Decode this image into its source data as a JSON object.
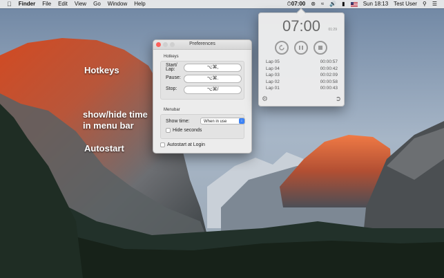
{
  "menubar": {
    "apple": "",
    "app_name": "Finder",
    "menus": [
      "File",
      "Edit",
      "View",
      "Go",
      "Window",
      "Help"
    ],
    "tray_timer": "07:00",
    "clock": "Sun 18:13",
    "user": "Test User"
  },
  "annotations": {
    "hotkeys": "Hotkeys",
    "showhide_line1": "show/hide time",
    "showhide_line2": "in menu bar",
    "autostart": "Autostart"
  },
  "preferences": {
    "title": "Preferences",
    "hotkeys_group": "Hotkeys",
    "hotkeys": [
      {
        "label": "Start/\nLap:",
        "value": "⌥⌘,"
      },
      {
        "label": "Pause:",
        "value": "⌥⌘."
      },
      {
        "label": "Stop:",
        "value": "⌥⌘/"
      }
    ],
    "menubar_group": "Menubar",
    "show_time_label": "Show time:",
    "show_time_value": "When in use",
    "hide_seconds_label": "Hide seconds",
    "autostart_label": "Autostart at Login"
  },
  "stopwatch": {
    "time": "07:00",
    "subtime": "01:29",
    "laps": [
      {
        "name": "Lap 05",
        "time": "00:00:57"
      },
      {
        "name": "Lap 04",
        "time": "00:00:42"
      },
      {
        "name": "Lap 03",
        "time": "00:02:09"
      },
      {
        "name": "Lap 02",
        "time": "00:00:58"
      },
      {
        "name": "Lap 01",
        "time": "00:00:43"
      }
    ]
  },
  "colors": {
    "accent": "#3b82f6",
    "close": "#fc605b",
    "cliff_glow": "#d4542a"
  }
}
